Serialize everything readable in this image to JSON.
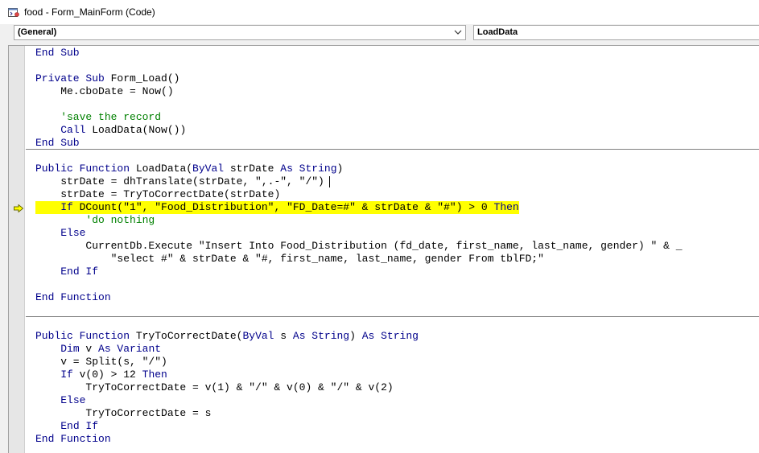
{
  "window": {
    "title": "food - Form_MainForm (Code)"
  },
  "object_combo": {
    "value": "(General)"
  },
  "procedure_combo": {
    "value": "LoadData"
  },
  "colors": {
    "keyword": "#00008b",
    "comment": "#008000",
    "text": "#000000",
    "highlight": "#ffff00",
    "execution_arrow": "#ffff00"
  },
  "code_lines": [
    {
      "segs": [
        {
          "t": "End Sub",
          "k": "kw"
        }
      ]
    },
    {
      "segs": []
    },
    {
      "segs": [
        {
          "t": "Private Sub",
          "k": "kw"
        },
        {
          "t": " Form_Load()",
          "k": "n"
        }
      ]
    },
    {
      "segs": [
        {
          "t": "    Me.cboDate = Now()",
          "k": "n"
        }
      ]
    },
    {
      "segs": []
    },
    {
      "segs": [
        {
          "t": "    'save the record",
          "k": "cm"
        }
      ]
    },
    {
      "segs": [
        {
          "t": "    ",
          "k": "n"
        },
        {
          "t": "Call",
          "k": "kw"
        },
        {
          "t": " LoadData(Now())",
          "k": "n"
        }
      ]
    },
    {
      "segs": [
        {
          "t": "End Sub",
          "k": "kw"
        }
      ]
    },
    {
      "segs": []
    },
    {
      "segs": [
        {
          "t": "Public Function",
          "k": "kw"
        },
        {
          "t": " LoadData(",
          "k": "n"
        },
        {
          "t": "ByVal",
          "k": "kw"
        },
        {
          "t": " strDate ",
          "k": "n"
        },
        {
          "t": "As String",
          "k": "kw"
        },
        {
          "t": ")",
          "k": "n"
        }
      ]
    },
    {
      "segs": [
        {
          "t": "    strDate = dhTranslate(strDate, \",.-\", \"/\")",
          "k": "n"
        }
      ]
    },
    {
      "segs": [
        {
          "t": "    strDate = TryToCorrectDate(strDate)",
          "k": "n"
        }
      ]
    },
    {
      "segs": [
        {
          "t": "    ",
          "k": "n"
        },
        {
          "t": "If",
          "k": "kw"
        },
        {
          "t": " DCount(\"1\", \"Food_Distribution\", \"FD_Date=#\" & strDate & \"#\") > 0 ",
          "k": "n"
        },
        {
          "t": "Then",
          "k": "kw"
        }
      ],
      "highlight": true
    },
    {
      "segs": [
        {
          "t": "        'do nothing",
          "k": "cm"
        }
      ]
    },
    {
      "segs": [
        {
          "t": "    ",
          "k": "n"
        },
        {
          "t": "Else",
          "k": "kw"
        }
      ]
    },
    {
      "segs": [
        {
          "t": "        CurrentDb.Execute \"Insert Into Food_Distribution (fd_date, first_name, last_name, gender) \" & _",
          "k": "n"
        }
      ]
    },
    {
      "segs": [
        {
          "t": "            \"select #\" & strDate & \"#, first_name, last_name, gender From tblFD;\"",
          "k": "n"
        }
      ]
    },
    {
      "segs": [
        {
          "t": "    ",
          "k": "n"
        },
        {
          "t": "End If",
          "k": "kw"
        }
      ]
    },
    {
      "segs": []
    },
    {
      "segs": [
        {
          "t": "End Function",
          "k": "kw"
        }
      ]
    },
    {
      "segs": []
    },
    {
      "segs": []
    },
    {
      "segs": [
        {
          "t": "Public Function",
          "k": "kw"
        },
        {
          "t": " TryToCorrectDate(",
          "k": "n"
        },
        {
          "t": "ByVal",
          "k": "kw"
        },
        {
          "t": " s ",
          "k": "n"
        },
        {
          "t": "As String",
          "k": "kw"
        },
        {
          "t": ") ",
          "k": "n"
        },
        {
          "t": "As String",
          "k": "kw"
        }
      ]
    },
    {
      "segs": [
        {
          "t": "    ",
          "k": "n"
        },
        {
          "t": "Dim",
          "k": "kw"
        },
        {
          "t": " v ",
          "k": "n"
        },
        {
          "t": "As Variant",
          "k": "kw"
        }
      ]
    },
    {
      "segs": [
        {
          "t": "    v = Split(s, \"/\")",
          "k": "n"
        }
      ]
    },
    {
      "segs": [
        {
          "t": "    ",
          "k": "n"
        },
        {
          "t": "If",
          "k": "kw"
        },
        {
          "t": " v(0) > 12 ",
          "k": "n"
        },
        {
          "t": "Then",
          "k": "kw"
        }
      ]
    },
    {
      "segs": [
        {
          "t": "        TryToCorrectDate = v(1) & \"/\" & v(0) & \"/\" & v(2)",
          "k": "n"
        }
      ]
    },
    {
      "segs": [
        {
          "t": "    ",
          "k": "n"
        },
        {
          "t": "Else",
          "k": "kw"
        }
      ]
    },
    {
      "segs": [
        {
          "t": "        TryToCorrectDate = s",
          "k": "n"
        }
      ]
    },
    {
      "segs": [
        {
          "t": "    ",
          "k": "n"
        },
        {
          "t": "End If",
          "k": "kw"
        }
      ]
    },
    {
      "segs": [
        {
          "t": "End Function",
          "k": "kw"
        }
      ]
    }
  ]
}
